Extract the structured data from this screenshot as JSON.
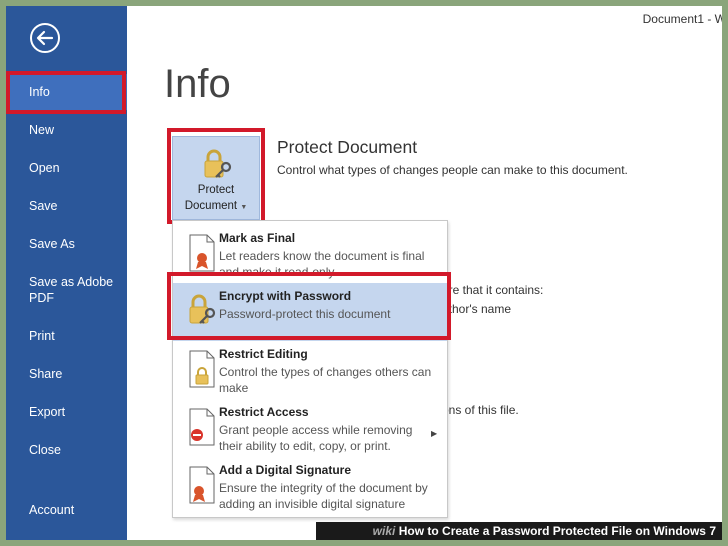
{
  "window_title": "Document1 - W",
  "sidebar": {
    "items": [
      {
        "label": "Info"
      },
      {
        "label": "New"
      },
      {
        "label": "Open"
      },
      {
        "label": "Save"
      },
      {
        "label": "Save As"
      },
      {
        "label": "Save as Adobe PDF"
      },
      {
        "label": "Print"
      },
      {
        "label": "Share"
      },
      {
        "label": "Export"
      },
      {
        "label": "Close"
      },
      {
        "label": "Account"
      }
    ],
    "active": "Info"
  },
  "page_title": "Info",
  "protect": {
    "button_line1": "Protect",
    "button_line2": "Document",
    "title": "Protect Document",
    "description": "Control what types of changes people can make to this document."
  },
  "background_text": {
    "line1": "are that it contains:",
    "line2": "uthor's name",
    "line3": "ons of this file."
  },
  "menu": {
    "items": [
      {
        "title": "Mark as Final",
        "desc": "Let readers know the document is final and make it read-only",
        "icon": "mark-final-icon"
      },
      {
        "title": "Encrypt with Password",
        "desc": "Password-protect this document",
        "icon": "lock-key-icon"
      },
      {
        "title": "Restrict Editing",
        "desc": "Control the types of changes others can make",
        "icon": "restrict-edit-icon"
      },
      {
        "title": "Restrict Access",
        "desc": "Grant people access while removing their ability to edit, copy, or print.",
        "icon": "restrict-access-icon"
      },
      {
        "title": "Add a Digital Signature",
        "desc": "Ensure the integrity of the document by adding an invisible digital signature",
        "icon": "signature-icon"
      }
    ],
    "selected": "Encrypt with Password"
  },
  "watermark": {
    "brand": "wiki",
    "text": "How to Create a Password Protected File on Windows 7"
  },
  "colors": {
    "sidebar": "#2b579a",
    "highlight": "#d2192a",
    "selected": "#c5d6ee"
  }
}
